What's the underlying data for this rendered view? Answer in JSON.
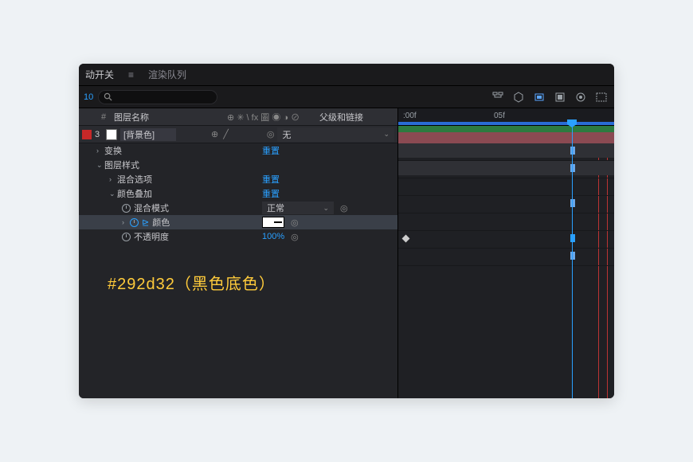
{
  "tabs": {
    "trunc": "动开关",
    "render_queue": "渲染队列"
  },
  "toolbar": {
    "frame_number": "10",
    "search_placeholder": ""
  },
  "columns": {
    "hash": "#",
    "layer_name": "图层名称",
    "switches": "⊕ ✳ \\ fx 圖 ◉ ◑ ⊘",
    "parent": "父级和链接"
  },
  "layer": {
    "index": "3",
    "name": "[背景色]",
    "parent": "无"
  },
  "props": {
    "transform": {
      "label": "变换",
      "reset": "重置"
    },
    "layer_styles": {
      "label": "图层样式"
    },
    "blending_options": {
      "label": "混合选项",
      "reset": "重置"
    },
    "color_overlay": {
      "label": "颜色叠加",
      "reset": "重置"
    },
    "blend_mode": {
      "label": "混合模式",
      "value": "正常"
    },
    "color": {
      "label": "颜色"
    },
    "opacity": {
      "label": "不透明度",
      "value": "100%"
    }
  },
  "timeline": {
    "ticks": [
      ":00f",
      "05f"
    ]
  },
  "annotation": "#292d32（黑色底色）",
  "colors": {
    "accent_blue": "#2aa0ff",
    "annotation_yellow": "#ffcb3b",
    "track_red": "#8b4a52",
    "track_green": "#2d7a3f",
    "panel_bg": "#232428"
  }
}
